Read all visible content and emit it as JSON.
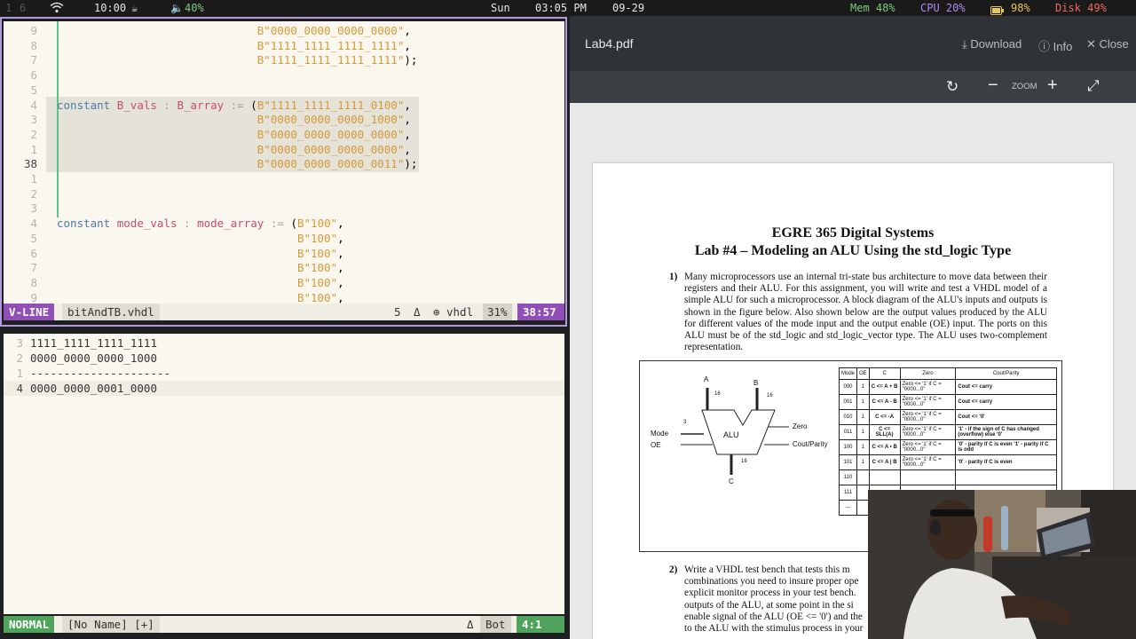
{
  "topbar": {
    "workspaces": [
      "1",
      "6"
    ],
    "wifi_icon": "wifi-icon",
    "time": "10:00",
    "cup_icon": "cup-icon",
    "volume": "40%",
    "day": "Sun",
    "clock": "03:05 PM",
    "date": "09-29",
    "mem": "Mem 48%",
    "cpu": "CPU 20%",
    "battery": "98%",
    "disk": "Disk 49%"
  },
  "editor_top": {
    "lines": [
      {
        "n": "9",
        "code": "                              B\"0000_0000_0000_0000\","
      },
      {
        "n": "8",
        "code": "                              B\"1111_1111_1111_1111\","
      },
      {
        "n": "7",
        "code": "                              B\"1111_1111_1111_1111\");"
      },
      {
        "n": "6",
        "code": ""
      },
      {
        "n": "5",
        "code": ""
      },
      {
        "n": "4",
        "code": "constant B_vals : B_array := (B\"1111_1111_1111_0100\","
      },
      {
        "n": "3",
        "code": "                              B\"0000_0000_0000_1000\","
      },
      {
        "n": "2",
        "code": "                              B\"0000_0000_0000_0000\","
      },
      {
        "n": "1",
        "code": "                              B\"0000_0000_0000_0000\","
      },
      {
        "n": "38",
        "code": "                              B\"0000_0000_0000_0011\");"
      },
      {
        "n": "1",
        "code": ""
      },
      {
        "n": "2",
        "code": ""
      },
      {
        "n": "3",
        "code": ""
      },
      {
        "n": "4",
        "code": "constant mode_vals : mode_array := (B\"100\","
      },
      {
        "n": "5",
        "code": "                                    B\"100\","
      },
      {
        "n": "6",
        "code": "                                    B\"100\","
      },
      {
        "n": "7",
        "code": "                                    B\"100\","
      },
      {
        "n": "8",
        "code": "                                    B\"100\","
      },
      {
        "n": "9",
        "code": "                                    B\"100\","
      }
    ],
    "status": {
      "mode": "V-LINE",
      "file": "bitAndTB.vhdl",
      "sel_count": "5",
      "branch_icon": "Δ",
      "filetype": "vhdl",
      "percent": "31%",
      "position": "38:57"
    }
  },
  "editor_bottom": {
    "lines": [
      {
        "n": "3",
        "text": "1111_1111_1111_1111"
      },
      {
        "n": "2",
        "text": "0000_0000_0000_1000"
      },
      {
        "n": "1",
        "text": "---------------------"
      },
      {
        "n": "4",
        "text": "0000_0000_0001_0000"
      }
    ],
    "status": {
      "mode": "NORMAL",
      "file": "[No Name] [+]",
      "branch_icon": "Δ",
      "scroll": "Bot",
      "position": "4:1"
    }
  },
  "pdf": {
    "filename": "Lab4.pdf",
    "download": "Download",
    "info": "Info",
    "close": "Close",
    "zoom_label": "ZOOM",
    "title1": "EGRE 365 Digital Systems",
    "title2": "Lab #4 – Modeling an ALU Using the std_logic Type",
    "item1_num": "1)",
    "item1": "Many microprocessors use an internal tri-state bus architecture to move data between their registers and their ALU. For this assignment, you will write and test a VHDL model of a simple ALU for such a microprocessor. A block diagram of the ALU's inputs and outputs is shown in the figure below. Also shown below are the output values produced by the ALU for different values of the mode input and the output enable (OE) input. The ports on this ALU must be of the std_logic and std_logic_vector type. The ALU uses two-complement representation.",
    "figure": {
      "a": "A",
      "b": "B",
      "w16a": "16",
      "w16b": "16",
      "w3": "3",
      "w16c": "16",
      "mode": "Mode",
      "oe": "OE",
      "alu": "ALU",
      "zero": "Zero",
      "cout": "Cout/Parity",
      "c": "C"
    },
    "table": {
      "headers": [
        "Mode",
        "OE",
        "C",
        "Zero",
        "Cout/Parity"
      ],
      "rows": [
        [
          "000",
          "1",
          "C <= A + B",
          "Zero <= '1' if C = \"0000...0\"",
          "Cout <= carry"
        ],
        [
          "001",
          "1",
          "C <= A - B",
          "Zero <= '1' if C = \"0000...0\"",
          "Cout <= carry"
        ],
        [
          "010",
          "1",
          "C <= -A",
          "Zero <= '1' if C = \"0000...0\"",
          "Cout <= '0'"
        ],
        [
          "011",
          "1",
          "C <= SLL(A)",
          "Zero <= '1' if C = \"0000...0\"",
          "'1' - if the sign of C has changed (overflow) else '0'"
        ],
        [
          "100",
          "1",
          "C <= A • B",
          "Zero <= '1' if C = \"0000...0\"",
          "'0' - parity if C is even '1' - parity if C is odd"
        ],
        [
          "101",
          "1",
          "C <= A | B",
          "Zero <= '1' if C = \"0000...0\"",
          "'0' - parity if C is even"
        ],
        [
          "110",
          "",
          "",
          "",
          ""
        ],
        [
          "111",
          "",
          "",
          "",
          ""
        ],
        [
          "---",
          "",
          "",
          "",
          ""
        ]
      ]
    },
    "item2_num": "2)",
    "item2_lines": [
      "Write a VHDL test bench that tests this m",
      "combinations you need to insure proper ope",
      "explicit monitor process in your test bench.",
      "outputs of the ALU, at some point in the si",
      "enable signal of the ALU (OE <= '0') and the",
      "to the ALU with the stimulus process in your"
    ]
  }
}
